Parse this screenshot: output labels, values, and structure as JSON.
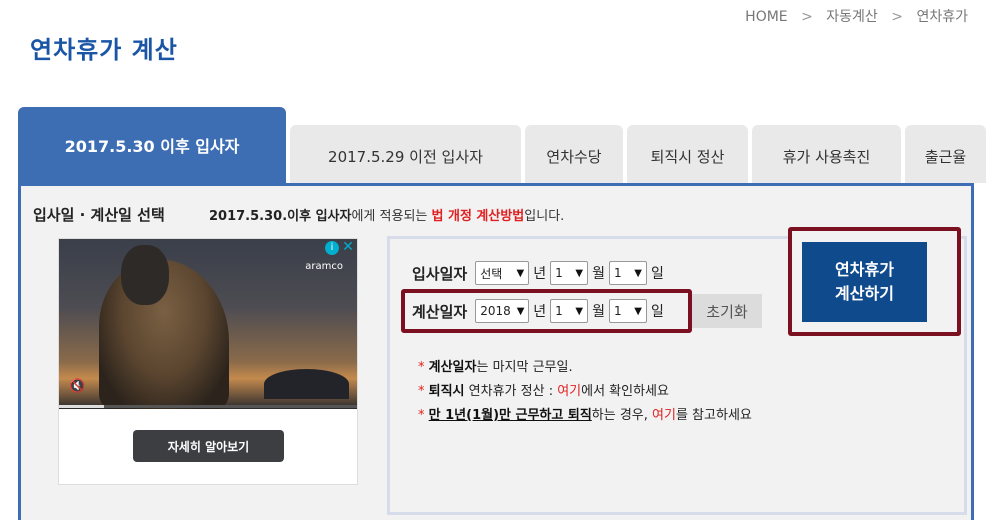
{
  "breadcrumb": [
    "HOME",
    "자동계산",
    "연차휴가"
  ],
  "breadcrumb_sep": ">",
  "page_title": "연차휴가 계산",
  "tabs": [
    {
      "label": "2017.5.30 이후 입사자",
      "active": true
    },
    {
      "label": "2017.5.29 이전 입사자",
      "active": false
    },
    {
      "label": "연차수당",
      "active": false
    },
    {
      "label": "퇴직시 정산",
      "active": false
    },
    {
      "label": "휴가 사용촉진",
      "active": false
    },
    {
      "label": "출근율",
      "active": false
    }
  ],
  "section_label": "입사일 · 계산일 선택",
  "description": {
    "part1": "2017.5.30.이후 입사자",
    "part2": "에게 적용되는 ",
    "part3": "법 개정 계산방법",
    "part4": "입니다."
  },
  "ad": {
    "brand": "aramco",
    "info_icon": "info-icon",
    "close_icon": "close-icon",
    "mute_icon": "mute-icon",
    "progress": 0.15,
    "button_label": "자세히 알아보기"
  },
  "join_date": {
    "label": "입사일자",
    "year": "선택",
    "month": "1",
    "day": "1"
  },
  "calc_date": {
    "label": "계산일자",
    "year": "2018",
    "month": "1",
    "day": "1"
  },
  "units": {
    "year": "년",
    "month": "월",
    "day": "일"
  },
  "reset_label": "초기화",
  "notes": [
    {
      "star": "*",
      "bold": "계산일자",
      "rest": "는 마지막 근무일."
    },
    {
      "star": "*",
      "bold": "퇴직시",
      "rest": " 연차휴가 정산 : ",
      "link": "여기",
      "rest2": "에서 확인하세요"
    },
    {
      "star": "*",
      "bold": "만 1년(1월)만 근무하고 퇴직",
      "rest": "하는 경우, ",
      "link": "여기",
      "rest2": "를 참고하세요"
    }
  ],
  "calc_button": {
    "line1": "연차휴가",
    "line2": "계산하기"
  },
  "colors": {
    "accent": "#3d6eb4",
    "title": "#1a55a6",
    "highlight": "#7a1020",
    "button": "#0f4a8c",
    "red": "#e02020"
  }
}
